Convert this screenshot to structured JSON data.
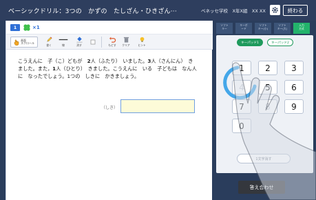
{
  "title_bar": {
    "title": "ベーシックドリル：3つの　かずの　たしざん・ひきざん···",
    "school": "ベネッセ学校　X年X組　XX XX",
    "end_button": "終わる"
  },
  "question": {
    "number": "1",
    "clover_count": "×1"
  },
  "toolbar": {
    "scroll": "画面\nスクロール",
    "pen": "書く",
    "line": "線",
    "eraser": "消す",
    "undo": "もどす",
    "clear": "クリア",
    "hint": "ヒント"
  },
  "problem": {
    "text_1": "こうえんに　子（こ）どもが　",
    "num_1": "2",
    "text_2": "人（ふたり）　いました。",
    "num_2": "3",
    "text_3": "人（さんにん）　きました。また，",
    "num_3": "1",
    "text_4": "人（ひとり）　きました。こうえんに　いる　子どもは　なん人に　なったでしょう。1つの　しきに　かきましょう。",
    "formula_label": "（しき）",
    "answer_value": ""
  },
  "keypad": {
    "mode_tabs": [
      "ソフト\nキー",
      "キーボ\nード",
      "ソフト\nキー(小)",
      "ソフト\nキー(大)",
      "入力\n方式"
    ],
    "active_mode_index": 4,
    "pad_tabs": [
      "キーパッド1",
      "キーパッド2"
    ],
    "active_pad_index": 0,
    "keys": [
      "1",
      "2",
      "3",
      "4",
      "5",
      "6",
      "7",
      "8",
      "9",
      "0"
    ],
    "dim_keys": [
      "4",
      "8"
    ],
    "erase_label": "1文字消す",
    "check_button": "答え合わせ"
  },
  "colors": {
    "frame": "#2a3d5c",
    "accent_green": "#1e9a5c",
    "accent_blue": "#2f6fd6",
    "answer_fill": "#fdfbd8",
    "swipe_arc": "#3aa2e8"
  }
}
